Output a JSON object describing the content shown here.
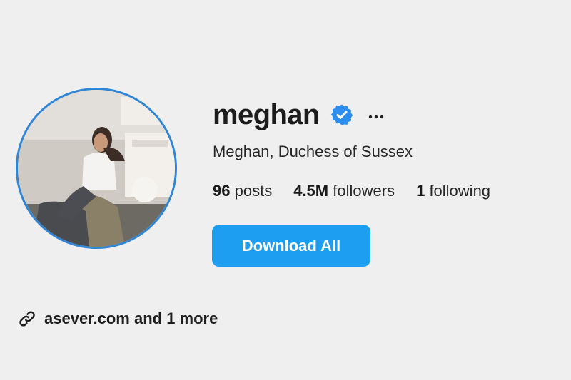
{
  "profile": {
    "username": "meghan",
    "verified": true,
    "full_name": "Meghan, Duchess of Sussex",
    "avatar_icon": "profile-photo",
    "verified_icon": "verified-badge-icon",
    "more_icon": "more-options-icon"
  },
  "stats": {
    "posts_count": "96",
    "posts_label": "posts",
    "followers_count": "4.5M",
    "followers_label": "followers",
    "following_count": "1",
    "following_label": "following"
  },
  "actions": {
    "download_label": "Download All"
  },
  "links": {
    "icon": "link-icon",
    "text": "asever.com and 1 more"
  },
  "colors": {
    "background": "#efeff0",
    "accent": "#1d9ef0",
    "verified": "#2d8ef0",
    "avatar_ring": "#2f86d8"
  }
}
